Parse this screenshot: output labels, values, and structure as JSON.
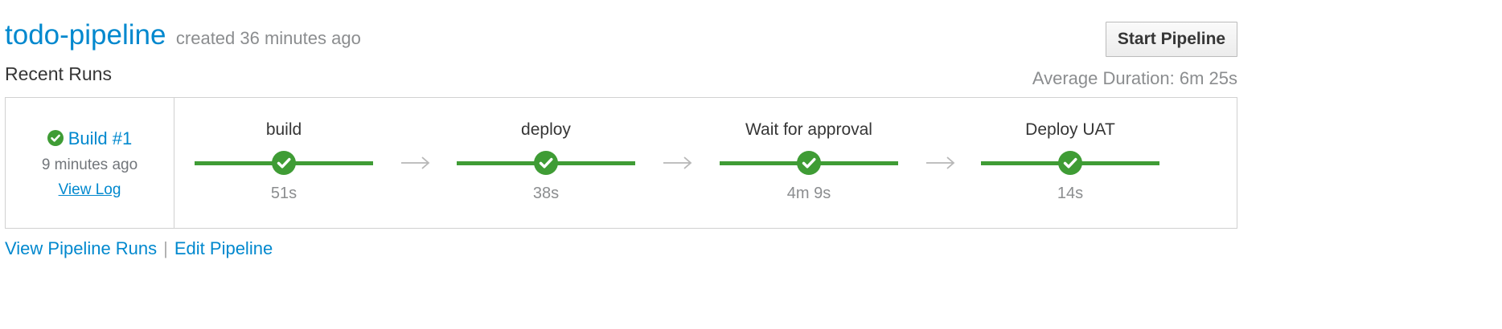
{
  "pipeline": {
    "name": "todo-pipeline",
    "created": "created 36 minutes ago",
    "start_button": "Start Pipeline",
    "recent_runs_label": "Recent Runs",
    "average_duration": "Average Duration: 6m 25s"
  },
  "run": {
    "build_label": "Build #1",
    "time": "9 minutes ago",
    "view_log": "View Log",
    "status": "success"
  },
  "stages": [
    {
      "name": "build",
      "duration": "51s",
      "status": "success"
    },
    {
      "name": "deploy",
      "duration": "38s",
      "status": "success"
    },
    {
      "name": "Wait for approval",
      "duration": "4m 9s",
      "status": "success"
    },
    {
      "name": "Deploy UAT",
      "duration": "14s",
      "status": "success"
    }
  ],
  "footer": {
    "view_runs": "View Pipeline Runs",
    "separator": "|",
    "edit": "Edit Pipeline"
  },
  "colors": {
    "link": "#0088ce",
    "success": "#3f9c35",
    "muted": "#8b8d8f"
  },
  "icons": [
    "check-circle-icon",
    "arrow-right-icon"
  ]
}
